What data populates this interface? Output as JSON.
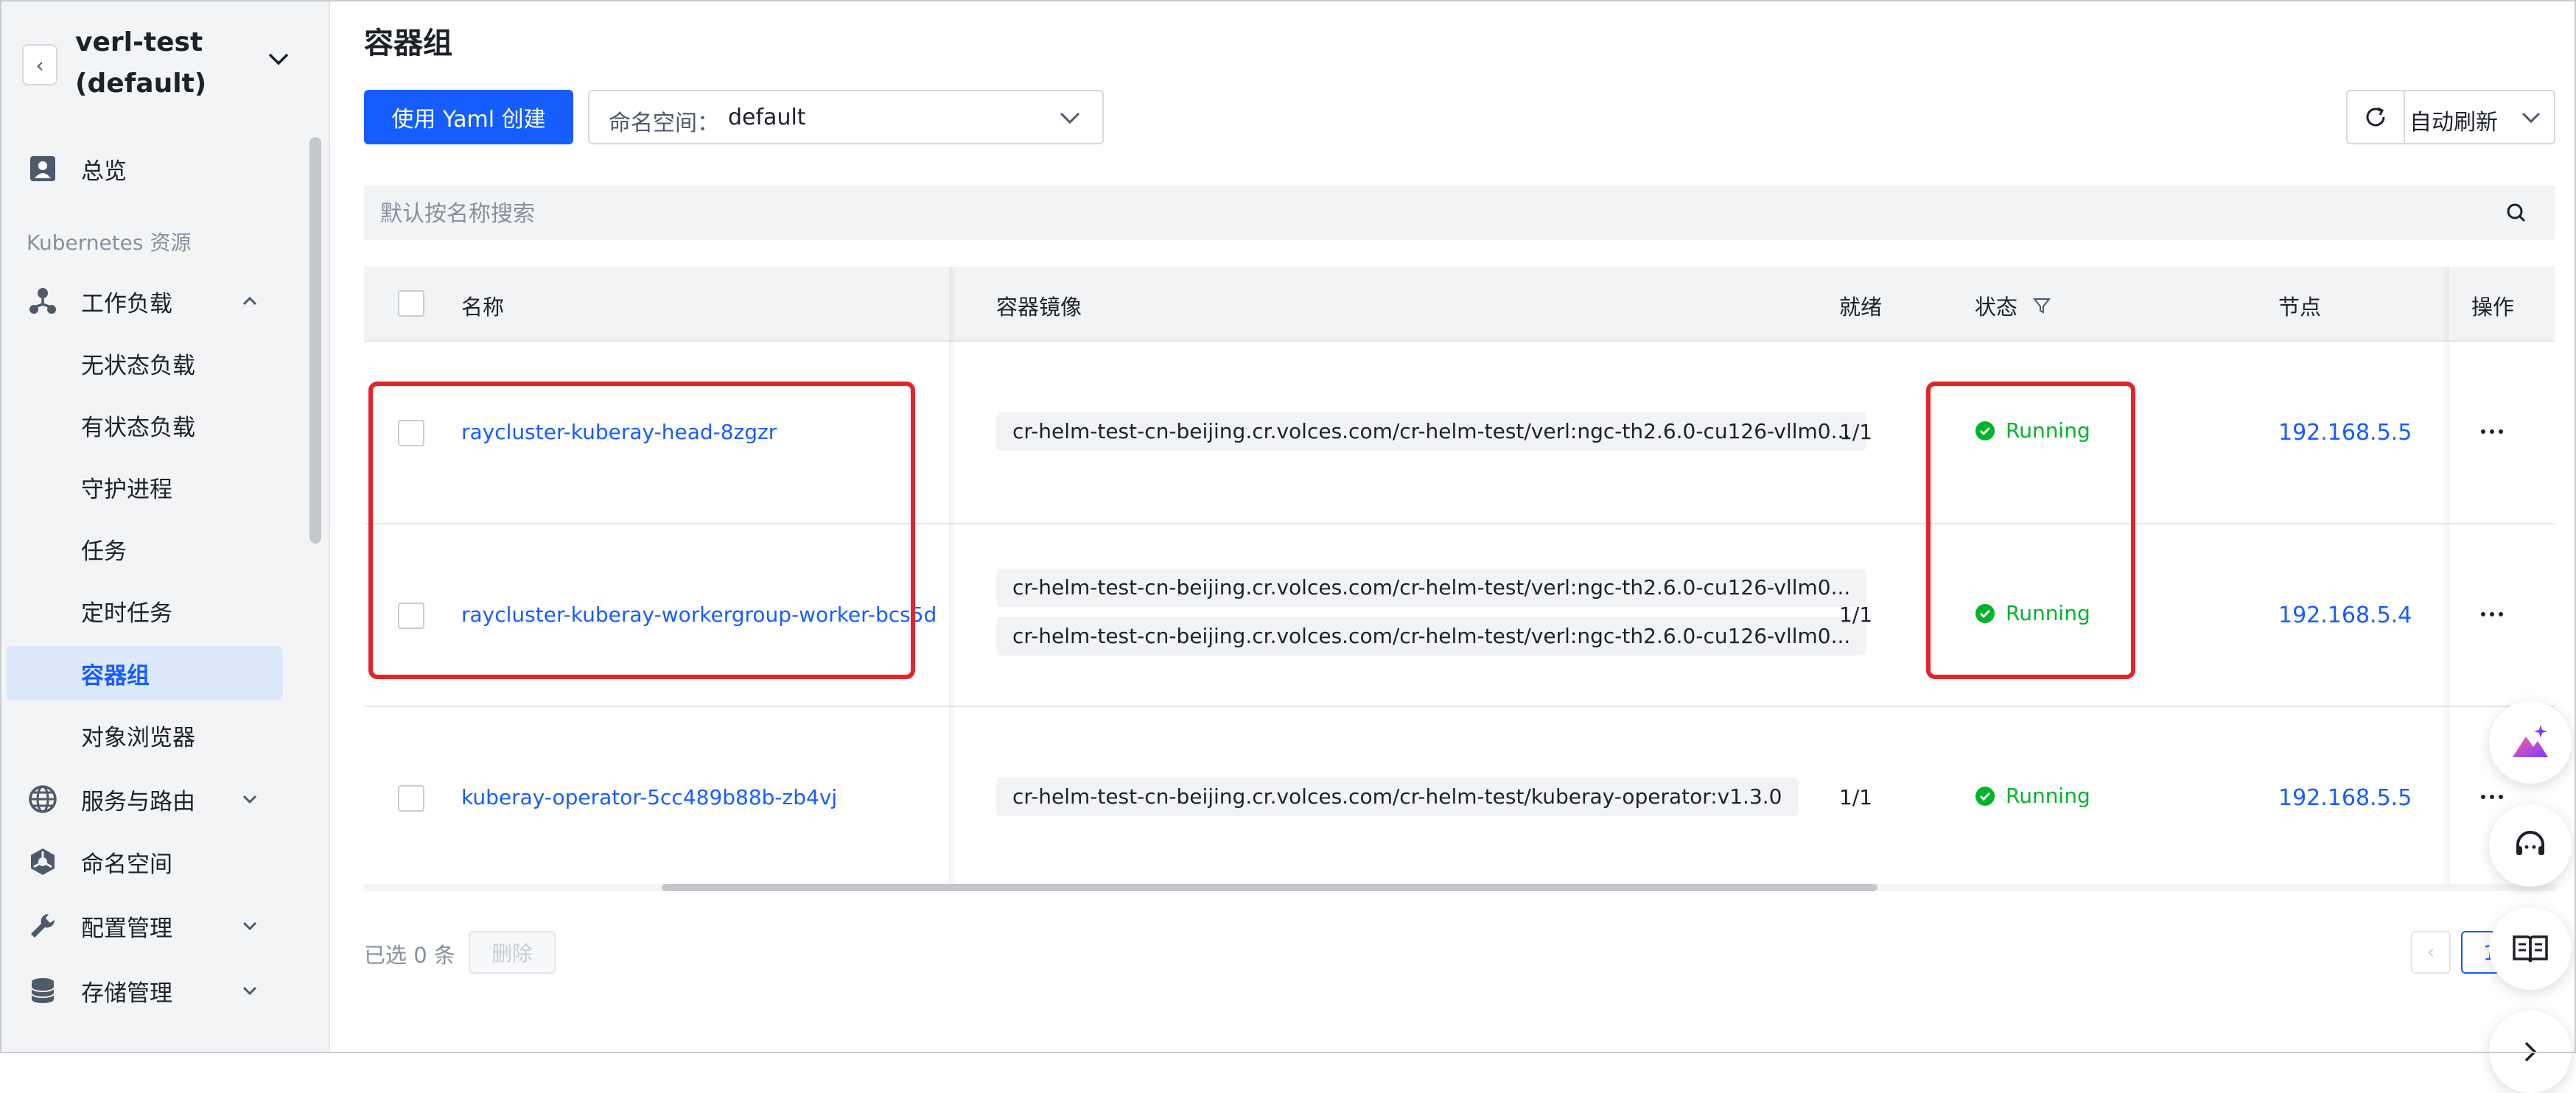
{
  "sidebar": {
    "cluster_name": "verl-test (default)",
    "overview": "总览",
    "section_label": "Kubernetes 资源",
    "workloads": "工作负载",
    "sub_items": [
      "无状态负载",
      "有状态负载",
      "守护进程",
      "任务",
      "定时任务",
      "容器组",
      "对象浏览器"
    ],
    "services": "服务与路由",
    "namespace": "命名空间",
    "config": "配置管理",
    "storage": "存储管理"
  },
  "header": {
    "title": "容器组",
    "yaml_button": "使用 Yaml 创建",
    "namespace_label": "命名空间：",
    "namespace_value": "default",
    "auto_refresh": "自动刷新"
  },
  "search": {
    "placeholder": "默认按名称搜索"
  },
  "table": {
    "columns": [
      "名称",
      "容器镜像",
      "就绪",
      "状态",
      "节点",
      "操作"
    ],
    "rows": [
      {
        "name": "raycluster-kuberay-head-8zgzr",
        "images": [
          "cr-helm-test-cn-beijing.cr.volces.com/cr-helm-test/verl:ngc-th2.6.0-cu126-vllm0..."
        ],
        "ready": "1/1",
        "status": "Running",
        "node": "192.168.5.5"
      },
      {
        "name": "raycluster-kuberay-workergroup-worker-bcs5d",
        "images": [
          "cr-helm-test-cn-beijing.cr.volces.com/cr-helm-test/verl:ngc-th2.6.0-cu126-vllm0...",
          "cr-helm-test-cn-beijing.cr.volces.com/cr-helm-test/verl:ngc-th2.6.0-cu126-vllm0..."
        ],
        "ready": "1/1",
        "status": "Running",
        "node": "192.168.5.4"
      },
      {
        "name": "kuberay-operator-5cc489b88b-zb4vj",
        "images": [
          "cr-helm-test-cn-beijing.cr.volces.com/cr-helm-test/kuberay-operator:v1.3.0"
        ],
        "ready": "1/1",
        "status": "Running",
        "node": "192.168.5.5"
      }
    ]
  },
  "footer": {
    "selected": "已选 0 条",
    "delete_button": "删除",
    "page": "1"
  },
  "colors": {
    "primary": "#165dff",
    "success": "#00b42a",
    "highlight": "#e5242a"
  }
}
